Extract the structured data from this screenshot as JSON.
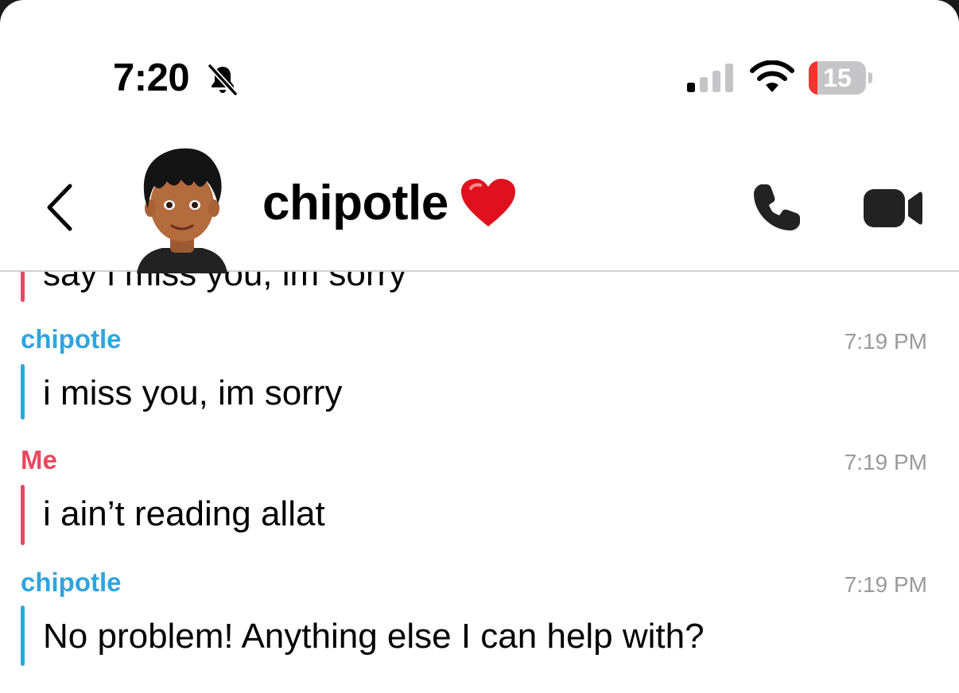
{
  "status_bar": {
    "time": "7:20",
    "battery_level": "15",
    "icons": [
      "bell-slash-icon",
      "cellular-signal-icon",
      "wifi-icon",
      "battery-icon"
    ]
  },
  "header": {
    "contact_name": "chipotle",
    "name_emoji_icon": "red-heart-icon",
    "buttons": [
      "back-chevron-icon",
      "phone-icon",
      "video-camera-icon"
    ]
  },
  "messages": [
    {
      "sender": "",
      "text": "say i miss you, im sorry",
      "time": "",
      "color": "#e8485f"
    },
    {
      "sender": "chipotle",
      "text": "i miss you, im sorry",
      "time": "7:19 PM",
      "color": "#2ea5df"
    },
    {
      "sender": "Me",
      "text": "i ain’t reading allat",
      "time": "7:19 PM",
      "color": "#e8485f"
    },
    {
      "sender": "chipotle",
      "text": "No problem! Anything else I can help with?",
      "time": "7:19 PM",
      "color": "#2ea5df"
    }
  ],
  "colors": {
    "friend_accent": "#2ea5df",
    "me_accent": "#e8485f",
    "timestamp": "#9a9a9e",
    "battery_low": "#f2352f"
  }
}
